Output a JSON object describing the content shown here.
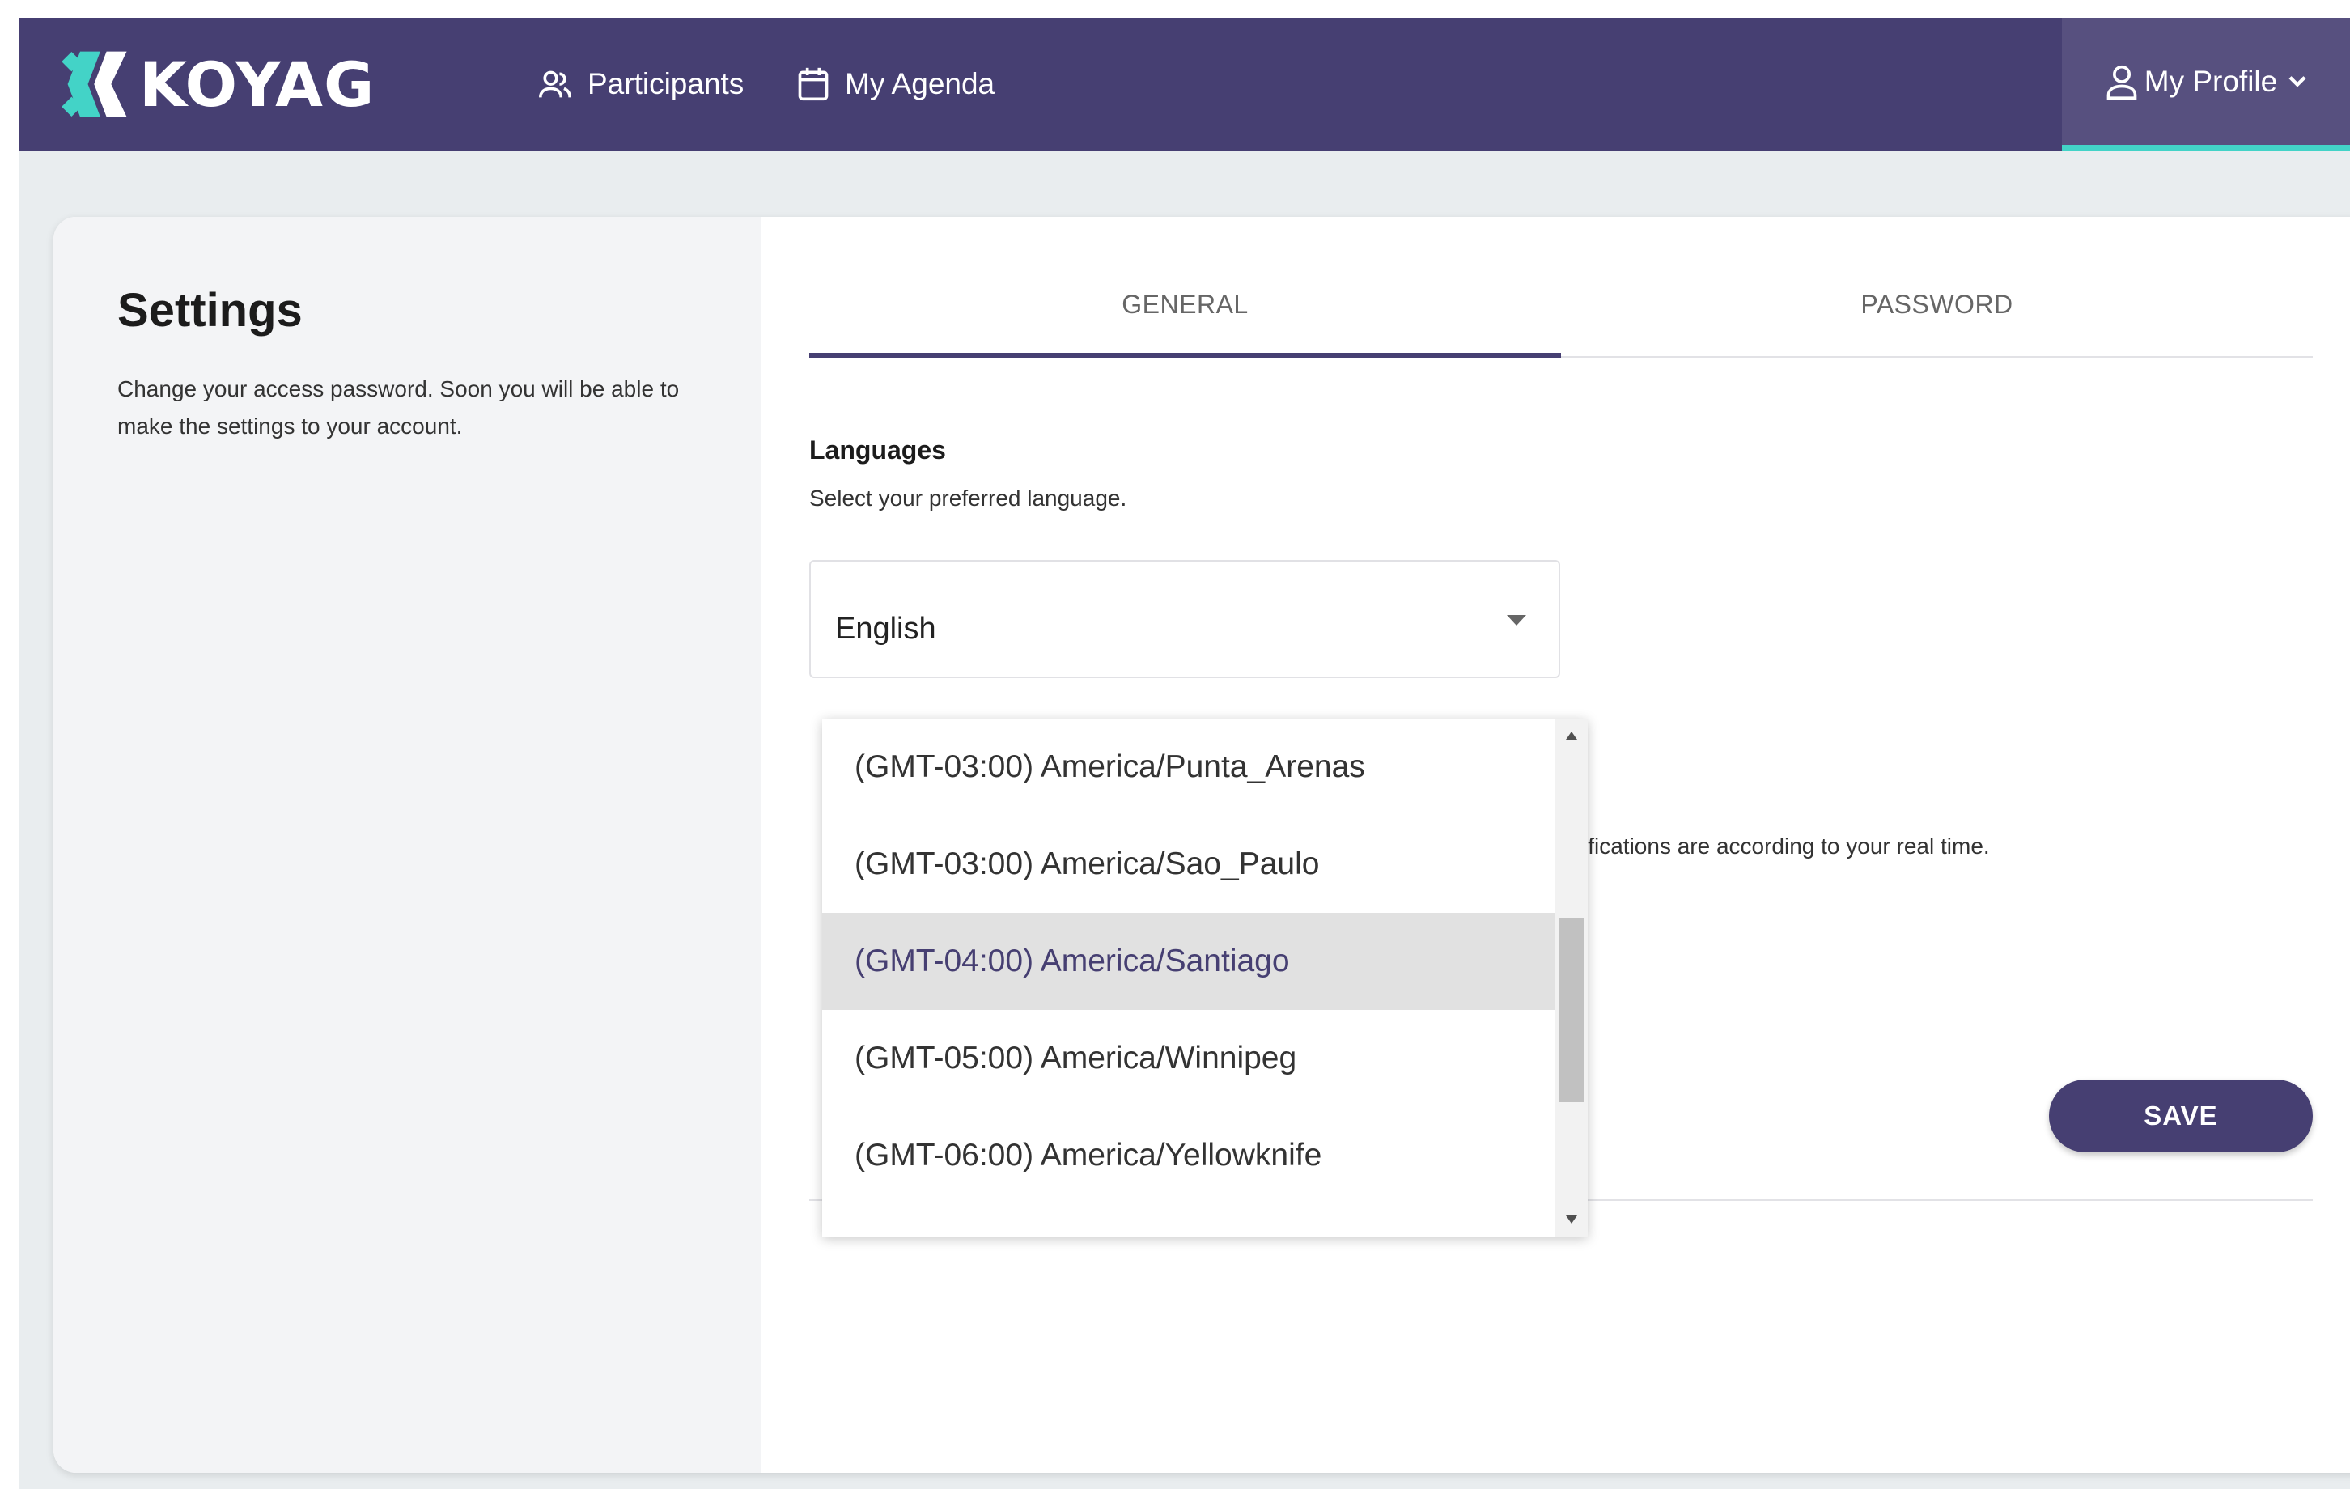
{
  "header": {
    "brand": "KOYAG",
    "nav": [
      {
        "label": "Participants",
        "icon": "people-icon"
      },
      {
        "label": "My Agenda",
        "icon": "calendar-icon"
      }
    ],
    "profile_label": "My Profile",
    "colors": {
      "bar": "#463f72",
      "profile_bg": "#57507f",
      "accent": "#43d3c7"
    }
  },
  "sidebar": {
    "title": "Settings",
    "description": "Change your access password. Soon you will be able to make the settings to your account."
  },
  "tabs": [
    {
      "label": "GENERAL",
      "active": true
    },
    {
      "label": "PASSWORD",
      "active": false
    }
  ],
  "languages": {
    "title": "Languages",
    "subtitle": "Select your preferred language.",
    "selected": "English"
  },
  "timezone": {
    "note_visible": "ifications are according to your real time.",
    "options": [
      "(GMT-03:00) America/Punta_Arenas",
      "(GMT-03:00) America/Sao_Paulo",
      "(GMT-04:00) America/Santiago",
      "(GMT-05:00) America/Winnipeg",
      "(GMT-06:00) America/Yellowknife"
    ],
    "highlighted": "(GMT-04:00) America/Santiago"
  },
  "actions": {
    "save_label": "SAVE"
  }
}
